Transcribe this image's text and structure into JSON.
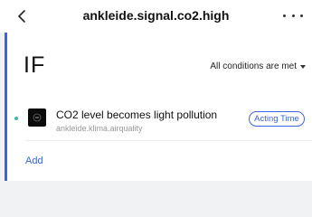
{
  "header": {
    "title": "ankleide.signal.co2.high",
    "back_icon": "chevron-left-icon",
    "more_icon": "more-horizontal-icon"
  },
  "condition_block": {
    "heading": "IF",
    "match_mode": "All conditions are met",
    "accent_color": "#3a64e0",
    "items": [
      {
        "title": "CO2 level becomes light pollution",
        "subtitle": "ankleide.klima.airquality",
        "badge": "Acting Time",
        "icon": "device-icon",
        "status_dot_color": "#3fb8a8"
      }
    ],
    "add_label": "Add"
  }
}
